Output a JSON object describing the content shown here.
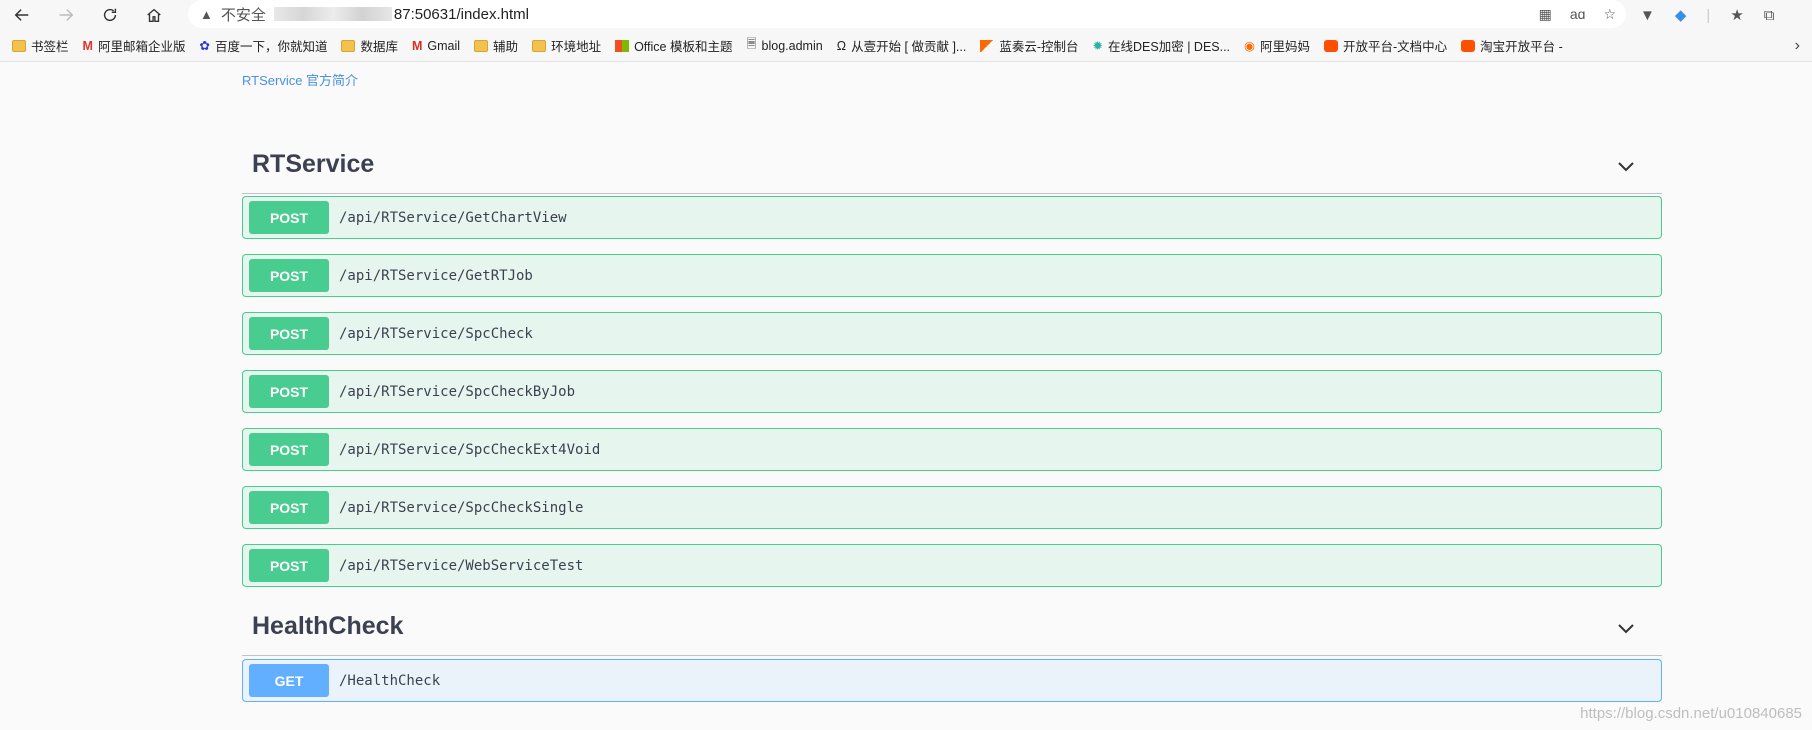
{
  "browser": {
    "address": {
      "not_secure": "不安全",
      "url_suffix": "87:50631/index.html"
    },
    "bookmarks": [
      {
        "label": "书签栏",
        "icon": "folder-icon"
      },
      {
        "label": "阿里邮箱企业版",
        "icon": "aliyun-mail-icon"
      },
      {
        "label": "百度一下，你就知道",
        "icon": "baidu-icon"
      },
      {
        "label": "数据库",
        "icon": "folder-icon"
      },
      {
        "label": "Gmail",
        "icon": "gmail-icon"
      },
      {
        "label": "辅助",
        "icon": "folder-icon"
      },
      {
        "label": "环境地址",
        "icon": "folder-icon"
      },
      {
        "label": "Office 模板和主题",
        "icon": "microsoft-icon"
      },
      {
        "label": "blog.admin",
        "icon": "page-icon"
      },
      {
        "label": "从壹开始 [ 做贡献 ]...",
        "icon": "site-icon"
      },
      {
        "label": "蓝奏云-控制台",
        "icon": "lanzou-icon"
      },
      {
        "label": "在线DES加密 | DES...",
        "icon": "gear-icon"
      },
      {
        "label": "阿里妈妈",
        "icon": "alimama-icon"
      },
      {
        "label": "开放平台-文档中心",
        "icon": "taobao-icon"
      },
      {
        "label": "淘宝开放平台 -",
        "icon": "taobao-icon"
      }
    ]
  },
  "page": {
    "intro_link": "RTService 官方简介",
    "sections": [
      {
        "title": "RTService",
        "operations": [
          {
            "method": "POST",
            "path": "/api/RTService/GetChartView"
          },
          {
            "method": "POST",
            "path": "/api/RTService/GetRTJob"
          },
          {
            "method": "POST",
            "path": "/api/RTService/SpcCheck"
          },
          {
            "method": "POST",
            "path": "/api/RTService/SpcCheckByJob"
          },
          {
            "method": "POST",
            "path": "/api/RTService/SpcCheckExt4Void"
          },
          {
            "method": "POST",
            "path": "/api/RTService/SpcCheckSingle"
          },
          {
            "method": "POST",
            "path": "/api/RTService/WebServiceTest"
          }
        ]
      },
      {
        "title": "HealthCheck",
        "operations": [
          {
            "method": "GET",
            "path": "/HealthCheck"
          }
        ]
      }
    ]
  },
  "watermark": "https://blog.csdn.net/u010840685",
  "colors": {
    "post": "#49cc90",
    "get": "#61affe",
    "link": "#4990e2",
    "text": "#3b4151"
  }
}
